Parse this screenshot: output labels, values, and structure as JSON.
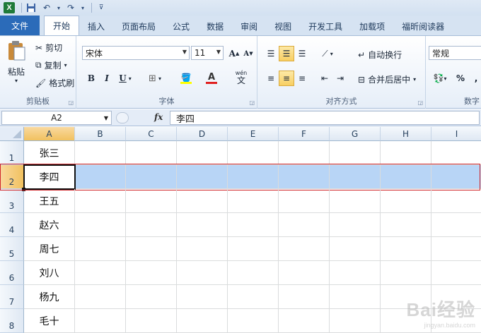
{
  "qat": {
    "icons": [
      "excel-logo",
      "save-icon",
      "undo-icon",
      "redo-icon",
      "customize-icon"
    ],
    "logo_text": "X"
  },
  "tabs": [
    "文件",
    "开始",
    "插入",
    "页面布局",
    "公式",
    "数据",
    "审阅",
    "视图",
    "开发工具",
    "加载项",
    "福昕阅读器"
  ],
  "ribbon": {
    "clipboard": {
      "label": "剪贴板",
      "paste": "粘贴",
      "cut": "剪切",
      "copy": "复制",
      "format_painter": "格式刷"
    },
    "font": {
      "label": "字体",
      "font_name": "宋体",
      "font_size": "11",
      "bold": "B",
      "italic": "I",
      "underline": "U",
      "grow": "A",
      "shrink": "A",
      "color_a": "A",
      "wen": "wén"
    },
    "alignment": {
      "label": "对齐方式",
      "wrap": "自动换行",
      "merge": "合并后居中"
    },
    "number": {
      "label": "数字",
      "format": "常规",
      "percent": "%",
      "comma": ","
    }
  },
  "formula_bar": {
    "name_box": "A2",
    "fx": "fx",
    "content": "李四"
  },
  "grid": {
    "columns": [
      "A",
      "B",
      "C",
      "D",
      "E",
      "F",
      "G",
      "H",
      "I"
    ],
    "rows": [
      "1",
      "2",
      "3",
      "4",
      "5",
      "6",
      "7",
      "8"
    ],
    "col_a_values": [
      "张三",
      "李四",
      "王五",
      "赵六",
      "周七",
      "刘八",
      "杨九",
      "毛十"
    ],
    "selected_row": 2
  },
  "colors": {
    "file_tab": "#2b6bb9",
    "row_selection": "#b8d5f6",
    "highlight_box": "#d0262a"
  },
  "watermark": {
    "main": "Bai经验",
    "sub": "jingyan.baidu.com"
  }
}
